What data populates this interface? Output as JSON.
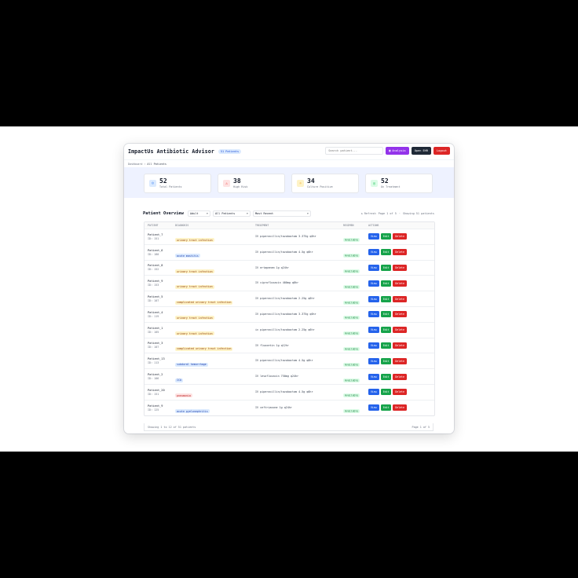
{
  "header": {
    "title": "ImpactUs Antibiotic Advisor",
    "patients_badge": "51 Patients",
    "search_placeholder": "Search patient...",
    "analysis_label": "Analysis",
    "ehr_label": "Open EHR",
    "logout_label": "Logout"
  },
  "breadcrumb": {
    "root": "Dashboard",
    "separator": "›",
    "current": "All Patients"
  },
  "stats": [
    {
      "value": "52",
      "label": "Total Patients",
      "icon": "users-icon",
      "color": "#3b82f6"
    },
    {
      "value": "38",
      "label": "High Risk",
      "icon": "warning-icon",
      "color": "#ef4444"
    },
    {
      "value": "34",
      "label": "Culture Positive",
      "icon": "lightbulb-icon",
      "color": "#f59e0b"
    },
    {
      "value": "52",
      "label": "On Treatment",
      "icon": "target-icon",
      "color": "#22c55e"
    }
  ],
  "toolbar": {
    "title": "Patient Overview",
    "filter_age": "Adult",
    "filter_patients": "All Patients",
    "sort": "Most Recent",
    "refresh_label": "↻ Refresh",
    "page_info": "Page 1 of 5",
    "showing": "Showing 51 patients"
  },
  "table": {
    "columns": [
      "PATIENT",
      "DIAGNOSIS",
      "TREATMENT",
      "REGIMEN",
      "ACTIONS"
    ],
    "rows": [
      {
        "name": "Patient_7",
        "id": "ID: 151",
        "diagnosis": "urinary tract infection",
        "tone": "amber",
        "treatment": "IV piperacillin/tazobactam 3.375g q6hr",
        "regimen": "Available"
      },
      {
        "name": "Patient_6",
        "id": "ID: 180",
        "diagnosis": "acute mastitis",
        "tone": "blue",
        "treatment": "IV piperacillin/tazobactam 4.5g q6hr",
        "regimen": "Available"
      },
      {
        "name": "Patient_8",
        "id": "ID: 152",
        "diagnosis": "urinary tract infection",
        "tone": "amber",
        "treatment": "IV ertapenem 1g q24hr",
        "regimen": "Available"
      },
      {
        "name": "Patient_9",
        "id": "ID: 153",
        "diagnosis": "urinary tract infection",
        "tone": "amber",
        "treatment": "IV ciprofloxacin 400mg q8hr",
        "regimen": "Available"
      },
      {
        "name": "Patient_5",
        "id": "ID: 107",
        "diagnosis": "complicated urinary tract infection",
        "tone": "amber",
        "treatment": "IV piperacillin/tazobactam 2.25g q6hr",
        "regimen": "Available"
      },
      {
        "name": "Patient_4",
        "id": "ID: 119",
        "diagnosis": "urinary tract infection",
        "tone": "amber",
        "treatment": "IV piperacillin/tazobactam 3.375g q6hr",
        "regimen": "Available"
      },
      {
        "name": "Patient_1",
        "id": "ID: 105",
        "diagnosis": "urinary tract infection",
        "tone": "amber",
        "treatment": "iv piperacillin/tazobactam 2.25g q6hr",
        "regimen": "Available"
      },
      {
        "name": "Patient_3",
        "id": "ID: 107",
        "diagnosis": "complicated urinary tract infection",
        "tone": "amber",
        "treatment": "IV fluoxetin 1g q12hr",
        "regimen": "Available"
      },
      {
        "name": "Patient_13",
        "id": "ID: 113",
        "diagnosis": "subdural hemorrhage",
        "tone": "blue",
        "treatment": "IV piperacillin/tazobactam 4.5g q6hr",
        "regimen": "Available"
      },
      {
        "name": "Patient_2",
        "id": "ID: 106",
        "diagnosis": "ICU",
        "tone": "blue",
        "treatment": "IV levofloxacin 750mg q24hr",
        "regimen": "Available"
      },
      {
        "name": "Patient_20",
        "id": "ID: 151",
        "diagnosis": "pneumonia",
        "tone": "red",
        "treatment": "IV piperacillin/tazobactam 4.5g q6hr",
        "regimen": "Available"
      },
      {
        "name": "Patient_9",
        "id": "ID: 125",
        "diagnosis": "acute pyelonephritis",
        "tone": "blue",
        "treatment": "IV ceftriaxone 1g q24hr",
        "regimen": "Available"
      }
    ],
    "action_view": "View",
    "action_edit": "Edit",
    "action_delete": "Delete"
  },
  "footer": {
    "showing": "Showing 1 to 12 of 51 patients",
    "page": "Page 1 of 5"
  }
}
